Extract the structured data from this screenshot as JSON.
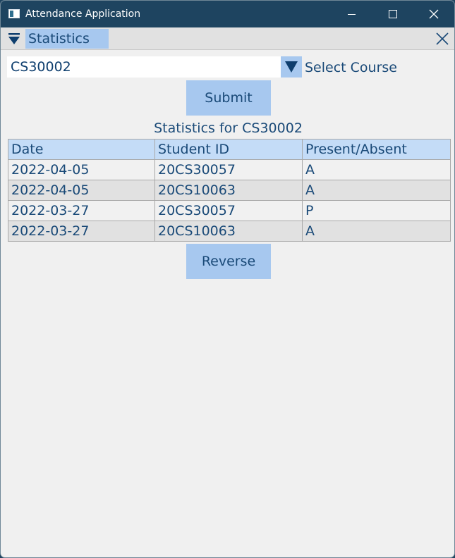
{
  "window": {
    "title": "Attendance Application",
    "minimize_glyph": "",
    "close_glyph": "✕"
  },
  "dock": {
    "title": "Statistics",
    "collapse_icon": "triangle-down-icon",
    "close_icon": "close-icon"
  },
  "course_select": {
    "value": "CS30002",
    "dropdown_icon": "triangle-down-icon",
    "label": "Select Course"
  },
  "submit_label": "Submit",
  "statistics_title": "Statistics for CS30002",
  "table": {
    "columns": [
      "Date",
      "Student ID",
      "Present/Absent"
    ],
    "rows": [
      [
        "2022-04-05",
        "20CS30057",
        "A"
      ],
      [
        "2022-04-05",
        "20CS10063",
        "A"
      ],
      [
        "2022-03-27",
        "20CS30057",
        "P"
      ],
      [
        "2022-03-27",
        "20CS10063",
        "A"
      ]
    ]
  },
  "reverse_label": "Reverse",
  "colors": {
    "titlebar": "#1e4460",
    "accent": "#a7c8ef",
    "text": "#1a4a78",
    "header_bg": "#c4dcf7"
  }
}
